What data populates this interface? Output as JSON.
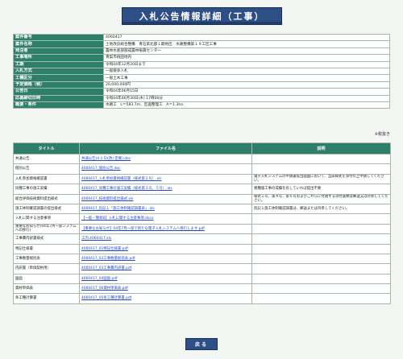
{
  "page_title": "入札公告情報詳細（工事）",
  "info_rows": [
    {
      "label": "案件番号",
      "value": "4060417"
    },
    {
      "label": "案件名称",
      "value": "土地改良総合整備　青石第北部１期地区　水路整備第１９工区工事"
    },
    {
      "label": "発注者",
      "value": "農林水産部部成農林振興センター"
    },
    {
      "label": "工事場所",
      "value": "青梨市飛田地内"
    },
    {
      "label": "工期",
      "value": "令和04年12月20日まで"
    },
    {
      "label": "入札方式",
      "value": "一般競争入札"
    },
    {
      "label": "工種区分",
      "value": "一般土木工事"
    },
    {
      "label": "予定価格（税）",
      "value": "20,000,000円"
    },
    {
      "label": "公告日",
      "value": "令和04年06月15日"
    },
    {
      "label": "応募締切日時",
      "value": "令和04年06月30日(木) 17時00分"
    },
    {
      "label": "概要・条件",
      "value": "水路工　L＝583.7m、区画整理工　A＝1.3ha"
    }
  ],
  "tax_note": "※税抜き",
  "file_table": {
    "headers": [
      "タイトル",
      "ファイル名",
      "説明"
    ],
    "rows": [
      {
        "title": "共通公告",
        "file": "共通公告(4.1.5)(改) 定要).doc",
        "desc": ""
      },
      {
        "title": "個別公告",
        "file": "4060417_個別公告.doc",
        "desc": ""
      },
      {
        "title": "入札参加資格確認書",
        "file": "4060417_入札参加資格確認書（様式第２号）.xls",
        "desc": "電子入札システムの申請書提出画面において、当該様式を添付の上申請してください。"
      },
      {
        "title": "同種工事の施工実績",
        "file": "4060417_同種工事の施工実績（様式第３号、５号）.xls",
        "desc": "異種施工事の成績を有していれば提出不要"
      },
      {
        "title": "総合評価技術資料提出様式",
        "file": "4060417_技術資料提出様式.xls",
        "desc": "様式１号、第４号、第６号およびこれらに付随する添付書類は郵送又は持参してください。"
      },
      {
        "title": "施工体制確認調書の提出様式",
        "file": "4060417_別記１「施工体制確認調書表」.xls",
        "desc": "別記１施工体制確認調書は、郵送または持参してください。"
      },
      {
        "title": "入札に関する注意事項",
        "file": "【一般・簡易B】入札に関する注意事項.docx",
        "desc": ""
      },
      {
        "title": "重要なお知らせ(04年7月一部システムへの移行)",
        "file": "【重要なお知らせ】04年7月一部で新たな電子入札システムへ移行します.pdf",
        "desc": ""
      },
      {
        "title": "工事費内訳書様式",
        "file": "工内.4060417.xls",
        "desc": ""
      },
      {
        "title": "特記仕様書",
        "file": "4060417_01特記仕様書.pdf",
        "desc": ""
      },
      {
        "title": "工事数量総括表",
        "file": "4060417_02工事数量総括表.pdf",
        "desc": ""
      },
      {
        "title": "内訳書（単価契約用）",
        "file": "4060417_03工事費内訳書.pdf",
        "desc": ""
      },
      {
        "title": "図面",
        "file": "4060417_04図面.pdf",
        "desc": ""
      },
      {
        "title": "資材単価表",
        "file": "4060417_06資材単価表.pdf",
        "desc": ""
      },
      {
        "title": "条工種計算書",
        "file": "4060417_05条工種計算書.pdf",
        "desc": ""
      }
    ]
  },
  "back_button": "戻る"
}
